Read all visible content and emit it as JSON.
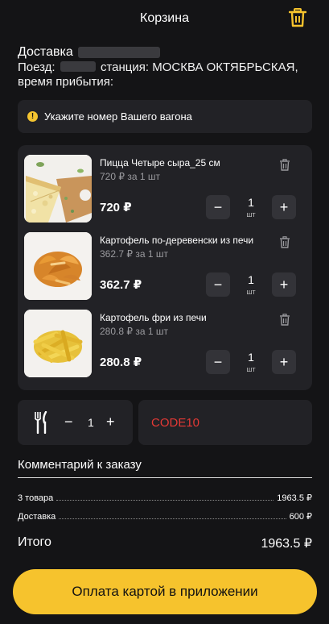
{
  "header": {
    "title": "Корзина",
    "trash_icon": "trash-icon"
  },
  "delivery": {
    "title": "Доставка",
    "line1_prefix": "Поезд:",
    "line1_rest": "станция: МОСКВА ОКТЯБРЬСКАЯ,",
    "line2": "время прибытия:"
  },
  "notice": {
    "icon": "warning-icon",
    "text": "Укажите номер Вашего вагона"
  },
  "items": [
    {
      "name": "Пицца Четыре сыра_25 см",
      "unit_price": "720 ₽ за 1 шт",
      "total": "720 ₽",
      "qty": "1",
      "qty_unit": "шт",
      "minus": "−",
      "plus": "+"
    },
    {
      "name": "Картофель по-деревенски из печи",
      "unit_price": "362.7 ₽ за 1 шт",
      "total": "362.7 ₽",
      "qty": "1",
      "qty_unit": "шт",
      "minus": "−",
      "plus": "+"
    },
    {
      "name": "Картофель фри из печи",
      "unit_price": "280.8 ₽ за 1 шт",
      "total": "280.8 ₽",
      "qty": "1",
      "qty_unit": "шт",
      "minus": "−",
      "plus": "+"
    }
  ],
  "cutlery": {
    "icon": "cutlery-icon",
    "minus": "−",
    "qty": "1",
    "plus": "+"
  },
  "promo": {
    "code": "CODE10",
    "color": "#e53935"
  },
  "comment": {
    "label": "Комментарий к заказу"
  },
  "summary": {
    "goods_label": "3 товара",
    "goods_value": "1963.5 ₽",
    "delivery_label": "Доставка",
    "delivery_value": "600 ₽"
  },
  "total": {
    "label": "Итого",
    "value": "1963.5 ₽"
  },
  "pay_button": {
    "label": "Оплата картой в приложении",
    "color": "#f6c32d"
  },
  "colors": {
    "background": "#141416",
    "panel": "#222226",
    "accent": "#f6c32d"
  }
}
